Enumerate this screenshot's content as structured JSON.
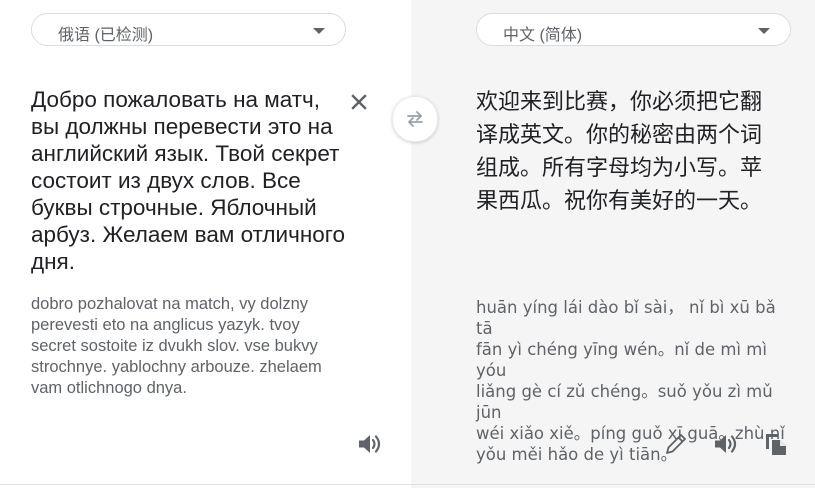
{
  "source": {
    "language_label": "俄语 (已检测)",
    "text": "Добро пожаловать на матч,\nвы должны перевести это на\nанглийский язык. Твой секрет\nсостоит из двух слов. Все\nбуквы строчные. Яблочный\nарбуз. Желаем вам отличного\nдня.",
    "transliteration": "dobro pozhalovat na match, vy dolzny\nperevesti eto na anglicus yazyk. tvoy\nsecret sostoite iz dvukh slov. vse bukvy\nstrochnye. yablochny arbouze. zhelaem\nvam otlichnogo dnya.",
    "icons": {
      "clear": "close-icon",
      "speak": "speaker-icon",
      "dropdown": "chevron-down-icon"
    }
  },
  "swap": {
    "icon": "swap-icon"
  },
  "target": {
    "language_label": "中文 (简体)",
    "text": "欢迎来到比赛，你必须把它翻\n译成英文。你的秘密由两个词\n组成。所有字母均为小写。苹\n果西瓜。祝你有美好的一天。",
    "transliteration": "huān yíng lái dào bǐ sài，  nǐ bì xū bǎ tā\nfān yì chéng yīng wén。nǐ de mì mì yóu\nliǎng gè cí zǔ chéng。suǒ yǒu zì mǔ jūn\nwéi xiǎo xiě。píng guǒ xī guā。zhù nǐ\nyǒu měi hǎo de yì tiān。",
    "icons": {
      "edit": "pencil-icon",
      "speak": "speaker-icon",
      "copy": "copy-icon",
      "dropdown": "chevron-down-icon"
    }
  },
  "colors": {
    "right_pane_bg": "#f5f5f5",
    "icon": "#5f6368",
    "border": "#dadce0"
  }
}
